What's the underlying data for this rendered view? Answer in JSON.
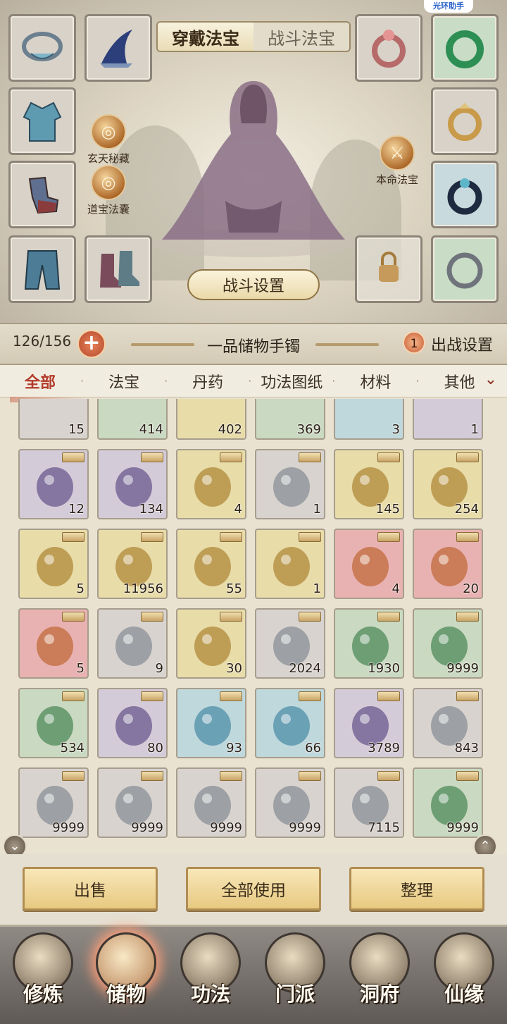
{
  "watermark": "光环助手",
  "equip_tabs": {
    "worn": "穿戴法宝",
    "combat": "战斗法宝"
  },
  "side_badges": {
    "xuantian": "玄天秘藏",
    "daobao": "道宝法囊",
    "benming": "本命法宝"
  },
  "battle_settings": "战斗设置",
  "capacity": {
    "count": "126/156",
    "plus": "+"
  },
  "bag_name": "一品储物手镯",
  "deploy": {
    "count": "1",
    "label": "出战设置"
  },
  "categories": [
    "全部",
    "法宝",
    "丹药",
    "功法图纸",
    "材料",
    "其他"
  ],
  "more_icon": "chevron-down-icon",
  "partial_row_qty": [
    "15",
    "414",
    "402",
    "369",
    "3",
    "1"
  ],
  "items": [
    {
      "qty": "12",
      "color": "purple",
      "icon": "blue-flame-orb"
    },
    {
      "qty": "134",
      "color": "purple",
      "icon": "purple-herb"
    },
    {
      "qty": "4",
      "color": "yellow",
      "icon": "bone-fragment"
    },
    {
      "qty": "1",
      "color": "gray",
      "icon": "green-orb"
    },
    {
      "qty": "145",
      "color": "yellow",
      "icon": "blue-powder"
    },
    {
      "qty": "254",
      "color": "yellow",
      "icon": "purple-powder"
    },
    {
      "qty": "5",
      "color": "yellow",
      "icon": "red-dragon-orb"
    },
    {
      "qty": "11956",
      "color": "yellow",
      "icon": "golden-orb"
    },
    {
      "qty": "55",
      "color": "yellow",
      "icon": "jade-crystal"
    },
    {
      "qty": "1",
      "color": "yellow",
      "icon": "yin-yang-jade"
    },
    {
      "qty": "4",
      "color": "red",
      "icon": "amber-egg"
    },
    {
      "qty": "20",
      "color": "red",
      "icon": "green-egg"
    },
    {
      "qty": "5",
      "color": "red",
      "icon": "blue-egg"
    },
    {
      "qty": "9",
      "color": "gray",
      "icon": "paper-scroll"
    },
    {
      "qty": "30",
      "color": "yellow",
      "icon": "dark-stone"
    },
    {
      "qty": "2024",
      "color": "gray",
      "icon": "ginseng-root"
    },
    {
      "qty": "1930",
      "color": "green",
      "icon": "pink-flower"
    },
    {
      "qty": "9999",
      "color": "green",
      "icon": "worm-root"
    },
    {
      "qty": "534",
      "color": "green",
      "icon": "worm-root"
    },
    {
      "qty": "80",
      "color": "purple",
      "icon": "dark-herb"
    },
    {
      "qty": "93",
      "color": "blue",
      "icon": "white-flower"
    },
    {
      "qty": "66",
      "color": "blue",
      "icon": "red-berry-branch"
    },
    {
      "qty": "3789",
      "color": "purple",
      "icon": "blue-berry-branch"
    },
    {
      "qty": "843",
      "color": "gray",
      "icon": "blue-flower"
    },
    {
      "qty": "9999",
      "color": "gray",
      "icon": "blue-flower-cluster"
    },
    {
      "qty": "9999",
      "color": "gray",
      "icon": "blue-flower-cluster"
    },
    {
      "qty": "9999",
      "color": "gray",
      "icon": "blue-flower-cluster"
    },
    {
      "qty": "9999",
      "color": "gray",
      "icon": "blue-flower-cluster"
    },
    {
      "qty": "7115",
      "color": "gray",
      "icon": "blue-flower-cluster"
    },
    {
      "qty": "9999",
      "color": "green",
      "icon": "bird-nest"
    },
    {
      "qty": "",
      "color": "green",
      "icon": "white-flower-cluster"
    },
    {
      "qty": "",
      "color": "gray",
      "icon": "white-flower-cluster"
    },
    {
      "qty": "",
      "color": "gray",
      "icon": "white-flower-cluster"
    },
    {
      "qty": "",
      "color": "gray",
      "icon": "white-flower-cluster"
    },
    {
      "qty": "",
      "color": "gray",
      "icon": "white-flower-cluster"
    },
    {
      "qty": "",
      "color": "gray",
      "icon": "white-flower-cluster"
    }
  ],
  "actions": {
    "sell": "出售",
    "use_all": "全部使用",
    "sort": "整理"
  },
  "nav": [
    "修炼",
    "储物",
    "功法",
    "门派",
    "洞府",
    "仙缘"
  ],
  "colors": {
    "gray": "#d8d3cf",
    "purple": "#d4cbd8",
    "yellow": "#e8dca9",
    "green": "#cad9c1",
    "red": "#e9b2b2",
    "blue": "#bfd8dc",
    "accent": "#b33a2a"
  }
}
